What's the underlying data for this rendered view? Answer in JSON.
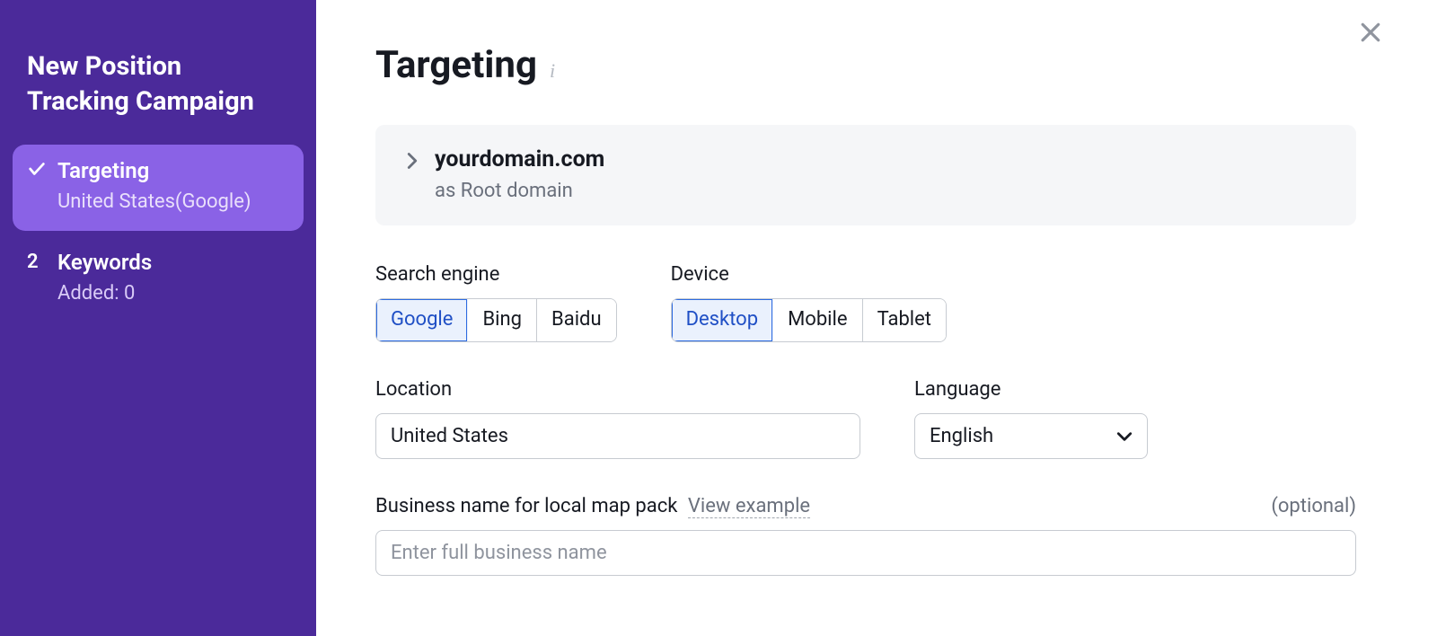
{
  "sidebar": {
    "title": "New Position Tracking Campaign",
    "steps": [
      {
        "label": "Targeting",
        "sub": "United States(Google)",
        "indicator": "check",
        "active": true
      },
      {
        "label": "Keywords",
        "sub": "Added: 0",
        "indicator": "2",
        "active": false
      }
    ]
  },
  "page": {
    "title": "Targeting"
  },
  "domain": {
    "name": "yourdomain.com",
    "subtype": "as Root domain"
  },
  "search_engine": {
    "label": "Search engine",
    "options": [
      "Google",
      "Bing",
      "Baidu"
    ],
    "selected": "Google"
  },
  "device": {
    "label": "Device",
    "options": [
      "Desktop",
      "Mobile",
      "Tablet"
    ],
    "selected": "Desktop"
  },
  "location": {
    "label": "Location",
    "value": "United States"
  },
  "language": {
    "label": "Language",
    "value": "English"
  },
  "business": {
    "label_prefix": "Business name for local map pack",
    "view_example": "View example",
    "optional": "(optional)",
    "placeholder": "Enter full business name",
    "value": ""
  }
}
